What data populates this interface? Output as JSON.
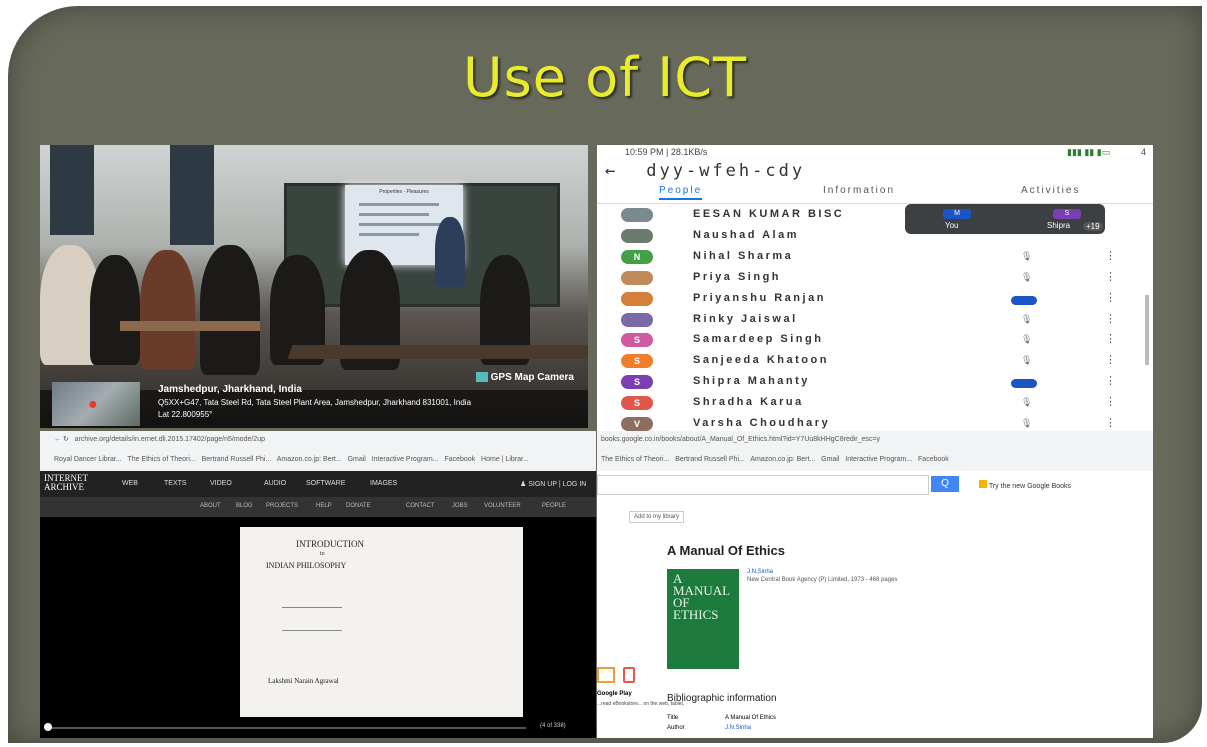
{
  "slide": {
    "title": "Use of ICT"
  },
  "photo": {
    "gps_badge": "GPS Map Camera",
    "location_title": "Jamshedpur, Jharkhand, India",
    "address": "Q5XX+G47, Tata Steel Rd, Tata Steel Plant Area, Jamshedpur, Jharkhand 831001, India",
    "lat": "Lat 22.800955°",
    "screen_title": "Properties · Pleasures"
  },
  "meet": {
    "status_time": "10:59 PM | 28.1KB/s",
    "status_right": "4",
    "meeting_code": "dyy-wfeh-cdy",
    "tabs": [
      "People",
      "Information",
      "Activities"
    ],
    "pip": {
      "you_initial": "M",
      "you_label": "You",
      "other_initial": "S",
      "other_label": "Shipra",
      "extra": "+19"
    },
    "participants": [
      {
        "initial": "",
        "name": "EESAN KUMAR BISC",
        "color": "#7a8a8e"
      },
      {
        "initial": "",
        "name": "Naushad Alam",
        "color": "#6a7a6e"
      },
      {
        "initial": "N",
        "name": "Nihal Sharma",
        "color": "#43a047"
      },
      {
        "initial": "",
        "name": "Priya Singh",
        "color": "#c08a5a"
      },
      {
        "initial": "",
        "name": "Priyanshu Ranjan",
        "color": "#d4803a"
      },
      {
        "initial": "",
        "name": "Rinky Jaiswal",
        "color": "#7a6aa8"
      },
      {
        "initial": "S",
        "name": "Samardeep Singh",
        "color": "#d05aa0"
      },
      {
        "initial": "S",
        "name": "Sanjeeda Khatoon",
        "color": "#ef7d2a"
      },
      {
        "initial": "S",
        "name": "Shipra Mahanty",
        "color": "#7b3fb3"
      },
      {
        "initial": "S",
        "name": "Shradha Karua",
        "color": "#e2574c"
      },
      {
        "initial": "V",
        "name": "Varsha Choudhary",
        "color": "#8d6e63"
      }
    ]
  },
  "archive": {
    "url": "archive.org/details/in.ernet.dli.2015.17402/page/n5/mode/2up",
    "bookmarks": [
      "Royal Dancer Librar...",
      "The Ethics of Theori...",
      "Bertrand Russell Phi...",
      "Amazon.co.jp: Bert...",
      "Gmail",
      "Interactive Program...",
      "Facebook",
      "Home | Librar..."
    ],
    "logo": [
      "INTERNET",
      "ARCHIVE"
    ],
    "nav": [
      "WEB",
      "TEXTS",
      "VIDEO",
      "AUDIO",
      "SOFTWARE",
      "IMAGES"
    ],
    "signin": "SIGN UP | LOG IN",
    "subnav": [
      "ABOUT",
      "BLOG",
      "PROJECTS",
      "HELP",
      "DONATE",
      "CONTACT",
      "JOBS",
      "VOLUNTEER",
      "PEOPLE"
    ],
    "book_title": "INTRODUCTION",
    "book_to": "to",
    "book_subtitle": "INDIAN PHILOSOPHY",
    "book_author": "Lakshmi Narain Agrawal",
    "page_count": "(4 of 338)"
  },
  "gbooks": {
    "url": "books.google.co.in/books/about/A_Manual_Of_Ethics.html?id=Y7Uu8kHHgC8redir_esc=y",
    "search_btn": "Q",
    "try_new": "Try the new Google Books",
    "add_library": "Add to my library",
    "title": "A Manual Of Ethics",
    "author": "J.N.Sinha",
    "publisher": "New Central Book Agency (P) Limited, 1973 - 468 pages",
    "cover_lines": [
      "A",
      "MANUAL",
      "OF",
      "ETHICS"
    ],
    "play_label": "Google Play",
    "play_desc": "...read eBookstore... on the web, tablet,",
    "biblio_heading": "Bibliographic information",
    "title_label": "Title",
    "title_value": "A Manual Of Ethics",
    "author_label": "Author",
    "author_value": "J.N.Sinha"
  }
}
